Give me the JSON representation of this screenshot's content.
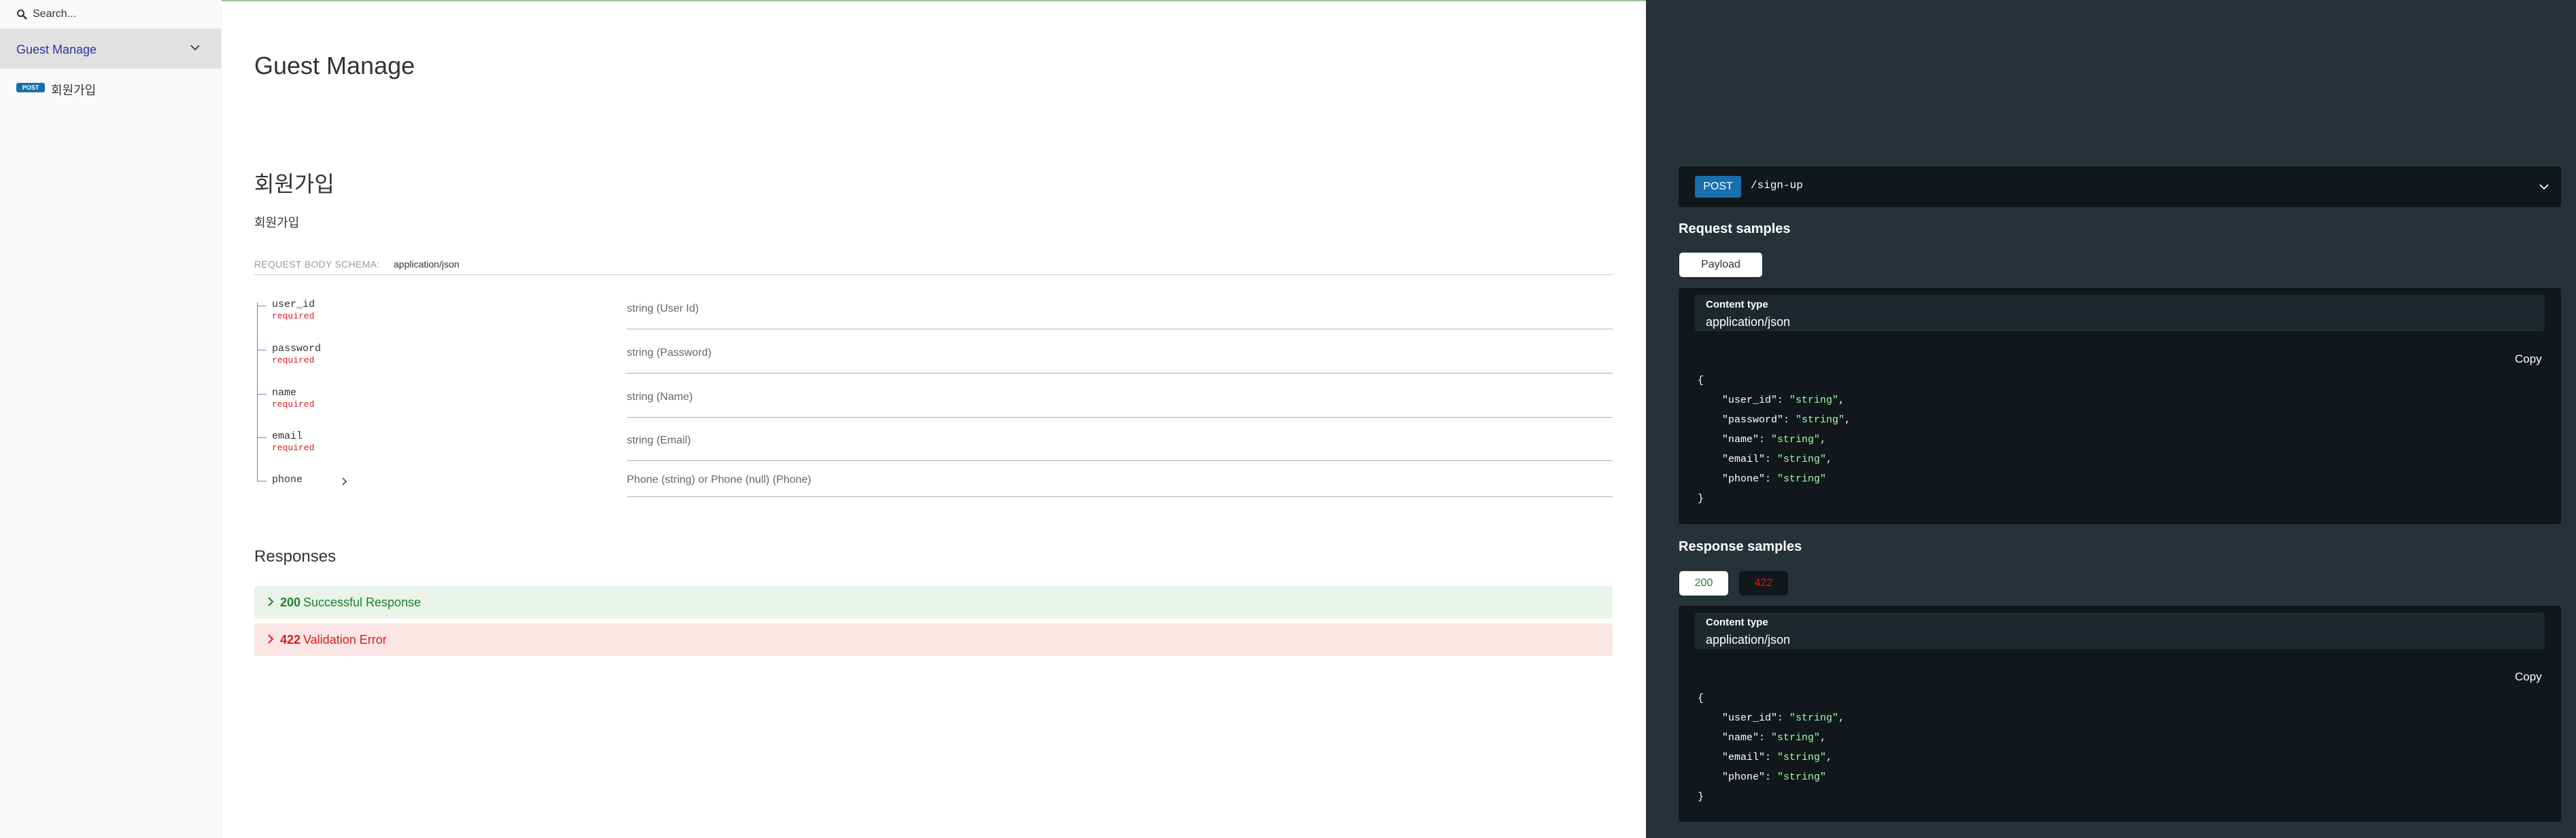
{
  "sidebar": {
    "search_placeholder": "Search...",
    "group_label": "Guest Manage",
    "operation": {
      "method": "POST",
      "label": "회원가입"
    }
  },
  "main": {
    "title": "Guest Manage",
    "operation_title": "회원가입",
    "operation_description": "회원가입",
    "schema_label": "REQUEST BODY SCHEMA:",
    "schema_type": "application/json",
    "fields": [
      {
        "name": "user_id",
        "required": "required",
        "type": "string (User Id)"
      },
      {
        "name": "password",
        "required": "required",
        "type": "string (Password)"
      },
      {
        "name": "name",
        "required": "required",
        "type": "string (Name)"
      },
      {
        "name": "email",
        "required": "required",
        "type": "string (Email)"
      },
      {
        "name": "phone",
        "required": "",
        "type": "Phone (string) or Phone (null) (Phone)"
      }
    ],
    "responses_title": "Responses",
    "responses": [
      {
        "code": "200",
        "text": "Successful Response"
      },
      {
        "code": "422",
        "text": "Validation Error"
      }
    ]
  },
  "right": {
    "method": "POST",
    "path": "/sign-up",
    "request_title": "Request samples",
    "request_tab": "Payload",
    "content_type_label": "Content type",
    "content_type_value": "application/json",
    "copy_label": "Copy",
    "request_json": [
      {
        "key": "\"user_id\"",
        "val": "\"string\"",
        "comma": ","
      },
      {
        "key": "\"password\"",
        "val": "\"string\"",
        "comma": ","
      },
      {
        "key": "\"name\"",
        "val": "\"string\"",
        "comma": ","
      },
      {
        "key": "\"email\"",
        "val": "\"string\"",
        "comma": ","
      },
      {
        "key": "\"phone\"",
        "val": "\"string\"",
        "comma": ""
      }
    ],
    "response_title": "Response samples",
    "response_tabs": [
      "200",
      "422"
    ],
    "response_json": [
      {
        "key": "\"user_id\"",
        "val": "\"string\"",
        "comma": ","
      },
      {
        "key": "\"name\"",
        "val": "\"string\"",
        "comma": ","
      },
      {
        "key": "\"email\"",
        "val": "\"string\"",
        "comma": ","
      },
      {
        "key": "\"phone\"",
        "val": "\"string\"",
        "comma": ""
      }
    ],
    "brace_open": "{",
    "brace_close": "}"
  },
  "colors": {
    "accent": "#32329f",
    "post_badge": "#186fad",
    "success": "#1d8127",
    "error": "#d41f1c",
    "panel_bg": "#263238",
    "code_bg": "#11171a",
    "string_green": "#a0fbaa"
  }
}
